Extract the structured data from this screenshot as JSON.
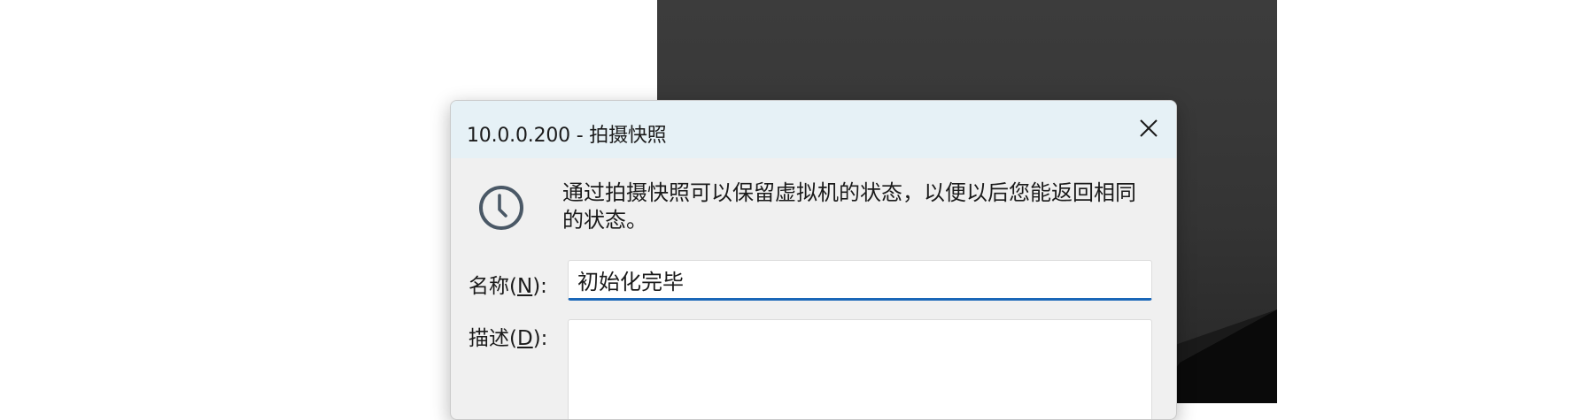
{
  "background_window": {
    "color": "#333333"
  },
  "dialog": {
    "title": "10.0.0.200 - 拍摄快照",
    "title_bar_color": "#e6f1f6",
    "accent_color": "#1a67b8",
    "close_icon": "close-icon",
    "info_icon": "clock-icon",
    "info_text": "通过拍摄快照可以保留虚拟机的状态，以便以后您能返回相同的状态。",
    "name": {
      "label": "名称",
      "mnemonic": "N",
      "value": "初始化完毕"
    },
    "description": {
      "label": "描述",
      "mnemonic": "D",
      "value": ""
    }
  }
}
